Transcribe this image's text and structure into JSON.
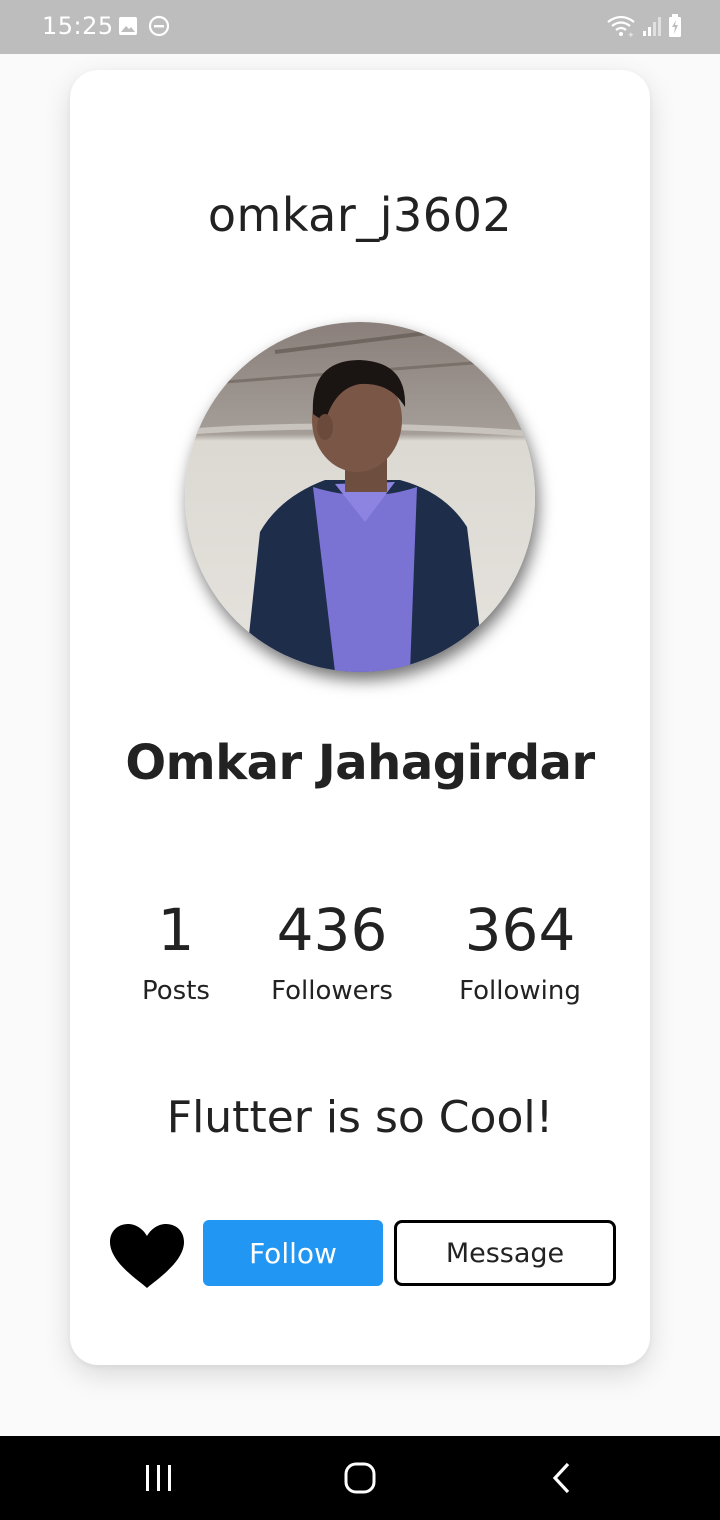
{
  "status_bar": {
    "time": "15:25",
    "left_icons": [
      "image-icon",
      "do-not-disturb-icon"
    ],
    "right_icons": [
      "wifi-icon",
      "signal-icon",
      "battery-charging-icon"
    ]
  },
  "profile": {
    "username": "omkar_j3602",
    "full_name": "Omkar Jahagirdar",
    "bio": "Flutter is so Cool!",
    "stats": [
      {
        "value": "1",
        "label": "Posts"
      },
      {
        "value": "436",
        "label": "Followers"
      },
      {
        "value": "364",
        "label": "Following"
      }
    ]
  },
  "actions": {
    "like_icon": "heart-icon",
    "follow_label": "Follow",
    "message_label": "Message"
  },
  "colors": {
    "accent": "#2196f3",
    "status_bar": "#bdbdbd",
    "nav_bar": "#000000",
    "text": "#222222"
  },
  "nav_bar": {
    "icons": [
      "recent-apps-icon",
      "home-icon",
      "back-icon"
    ]
  }
}
